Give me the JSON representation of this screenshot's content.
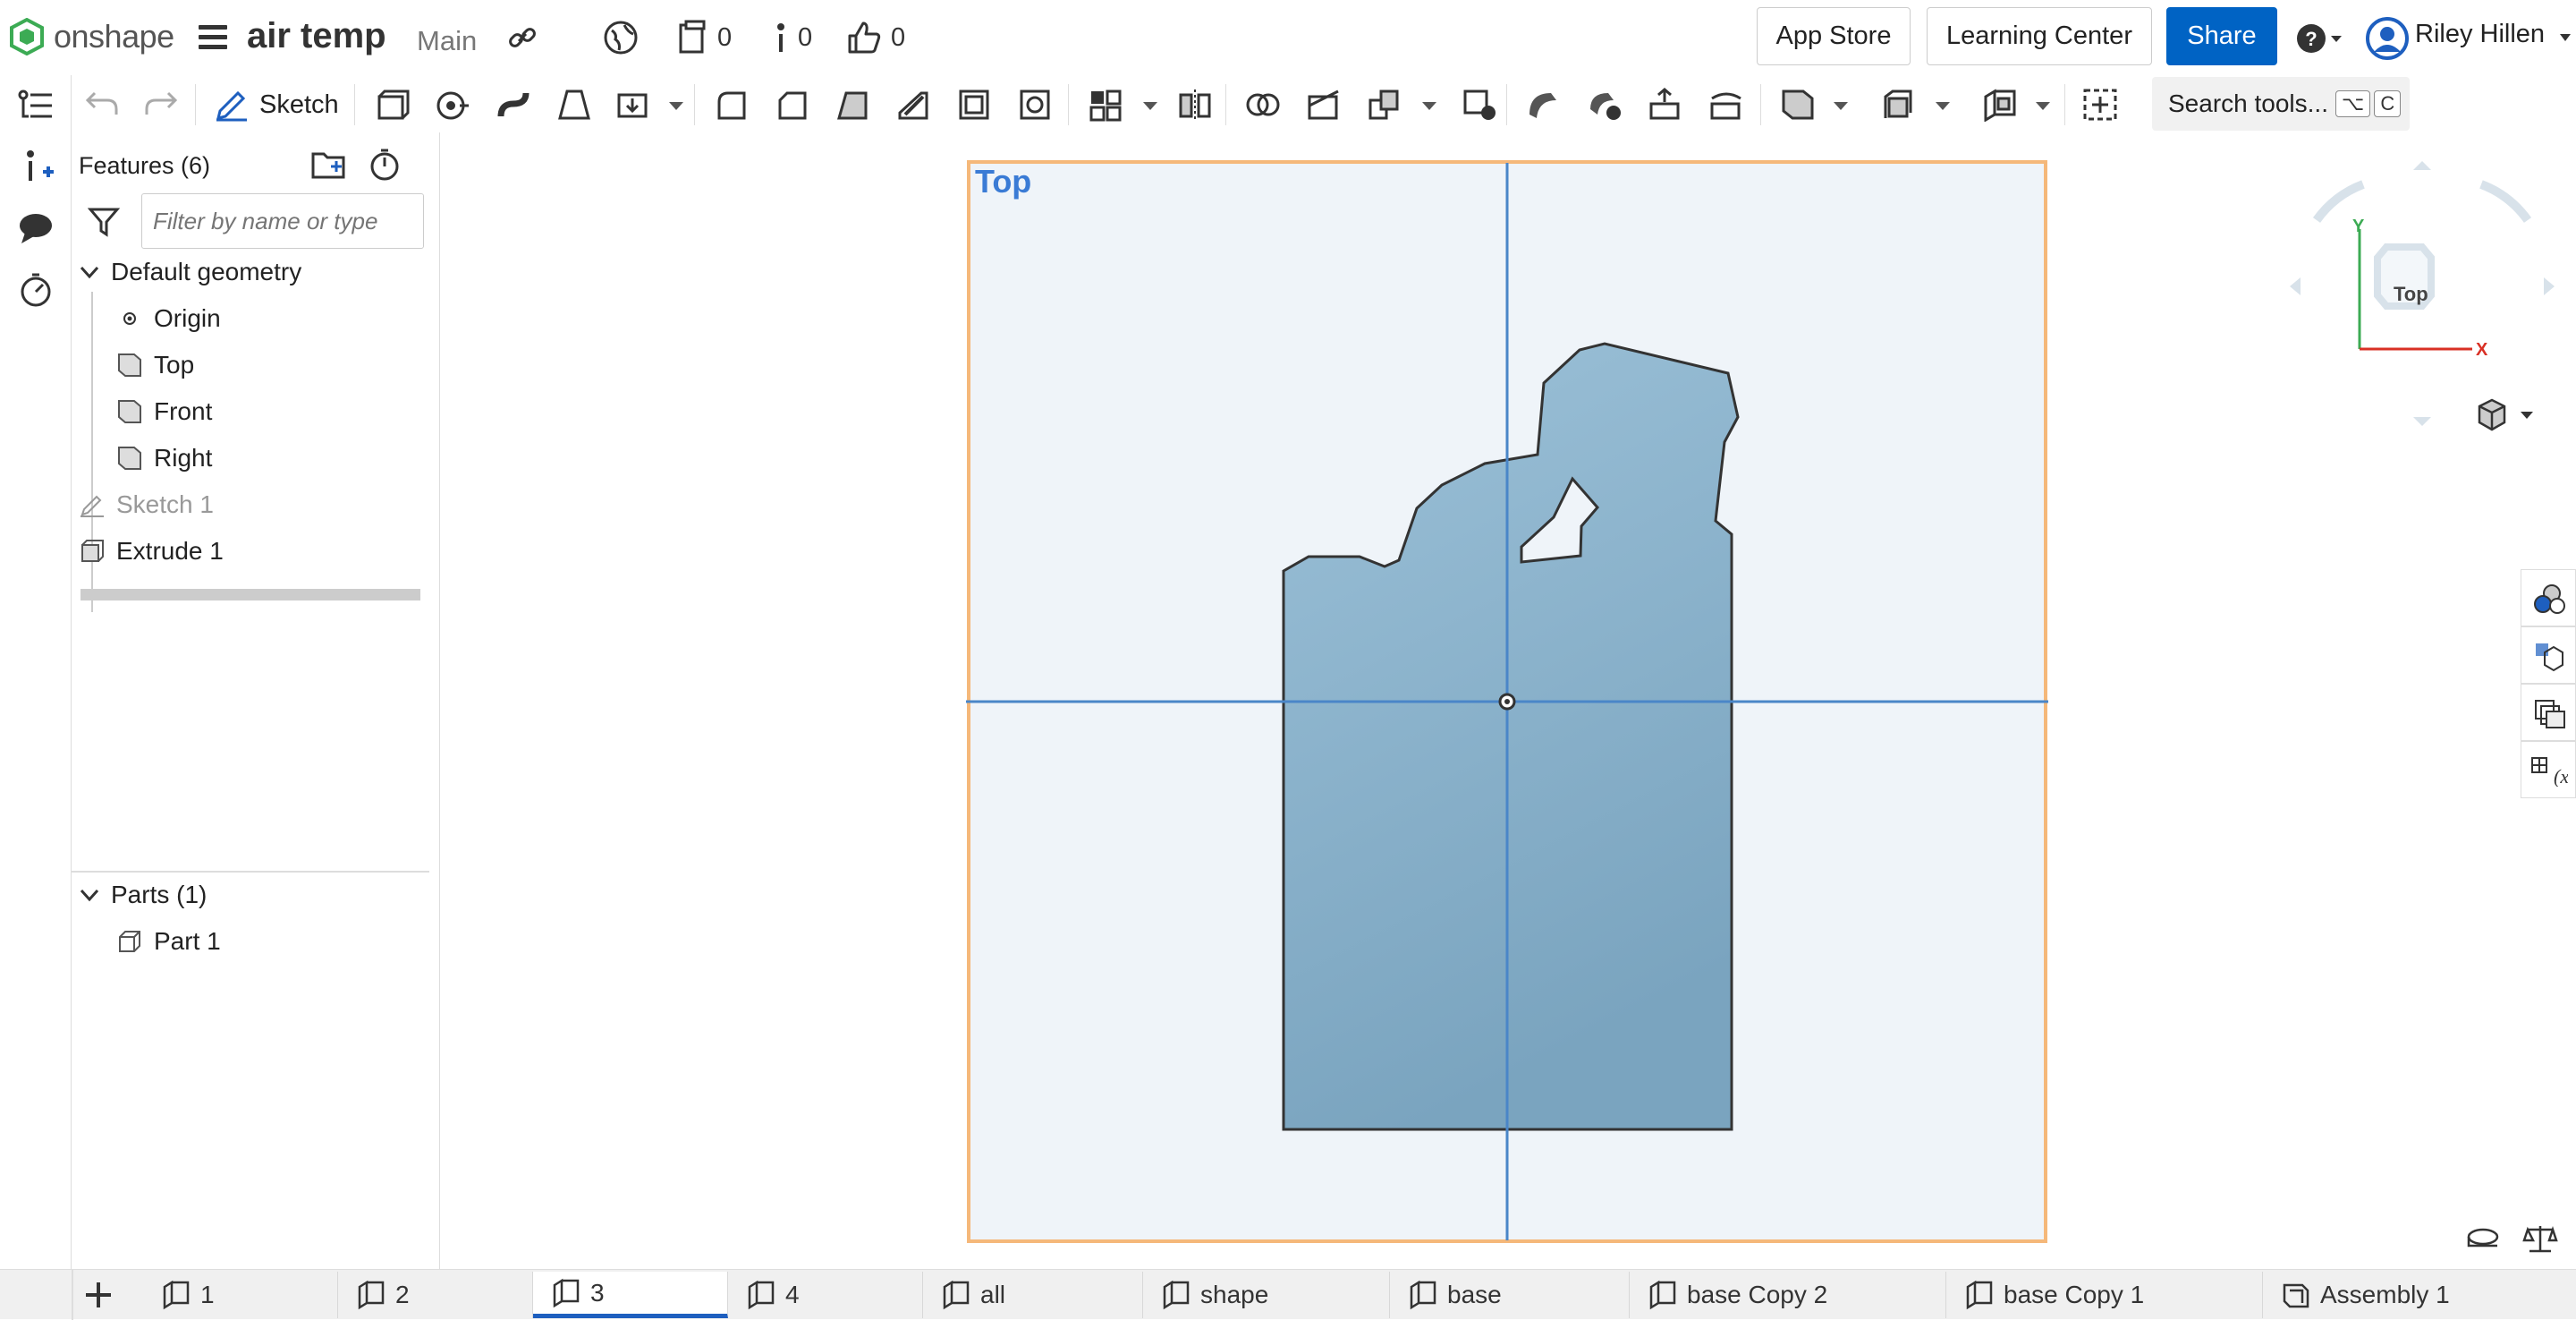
{
  "app": {
    "brand": "onshape",
    "doc_title": "air temp",
    "branch": "Main"
  },
  "topbar": {
    "versions_count": "0",
    "info_count": "0",
    "likes_count": "0",
    "app_store": "App Store",
    "learning_center": "Learning Center",
    "share": "Share",
    "user_name": "Riley Hillen"
  },
  "toolbar": {
    "sketch_label": "Sketch",
    "search_label": "Search tools...",
    "shortcut_1": "⌥",
    "shortcut_2": "C"
  },
  "features": {
    "title": "Features (6)",
    "filter_placeholder": "Filter by name or type",
    "default_geometry": "Default geometry",
    "items": [
      "Origin",
      "Top",
      "Front",
      "Right"
    ],
    "sketch": "Sketch 1",
    "extrude": "Extrude 1"
  },
  "parts": {
    "title": "Parts (1)",
    "items": [
      "Part 1"
    ]
  },
  "viewport": {
    "plane_label": "Top",
    "cube_face": "Top",
    "axis_x": "X",
    "axis_y": "Y"
  },
  "tabs": [
    "1",
    "2",
    "3",
    "4",
    "all",
    "shape",
    "base",
    "base Copy 2",
    "base Copy 1",
    "Assembly 1"
  ],
  "active_tab": "3",
  "colors": {
    "accent": "#0063c4",
    "plane_border": "#f5b87a",
    "part_fill": "#8db4ce",
    "axis": "#4a86c8"
  }
}
